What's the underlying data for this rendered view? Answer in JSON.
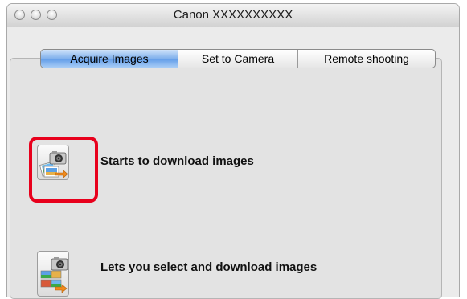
{
  "window": {
    "title": "Canon XXXXXXXXXX",
    "controls": [
      "close-button",
      "minimize-button",
      "zoom-button"
    ]
  },
  "tabs": [
    {
      "label": "Acquire Images",
      "active": true
    },
    {
      "label": "Set to Camera",
      "active": false
    },
    {
      "label": "Remote shooting",
      "active": false
    }
  ],
  "actions": [
    {
      "label": "Starts to download images",
      "icon": "camera-download-icon",
      "highlighted": true
    },
    {
      "label": "Lets you select and download images",
      "icon": "camera-select-download-icon",
      "highlighted": false
    }
  ],
  "colors": {
    "active_tab": "#6ea6ec",
    "highlight": "#e8001c",
    "arrow": "#f08a1c"
  }
}
